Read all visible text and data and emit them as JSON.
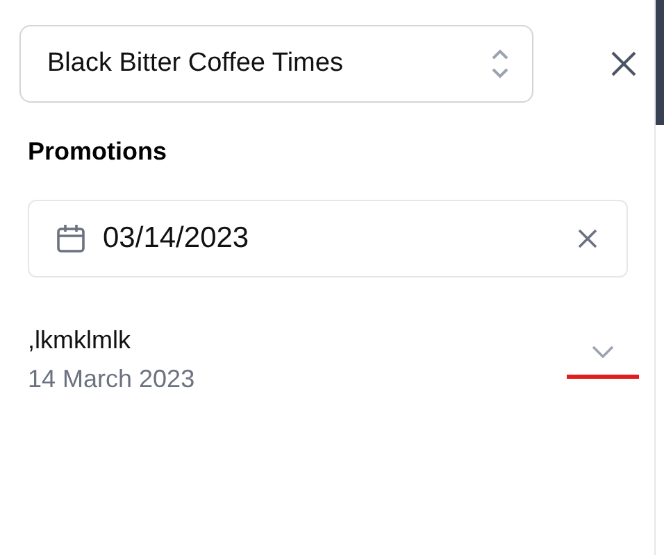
{
  "store_select": {
    "value": "Black Bitter Coffee Times"
  },
  "section_title": "Promotions",
  "date_filter": {
    "value": "03/14/2023"
  },
  "promotions": [
    {
      "title": ",lkmklmlk",
      "date": "14 March 2023",
      "expanded": false
    }
  ]
}
